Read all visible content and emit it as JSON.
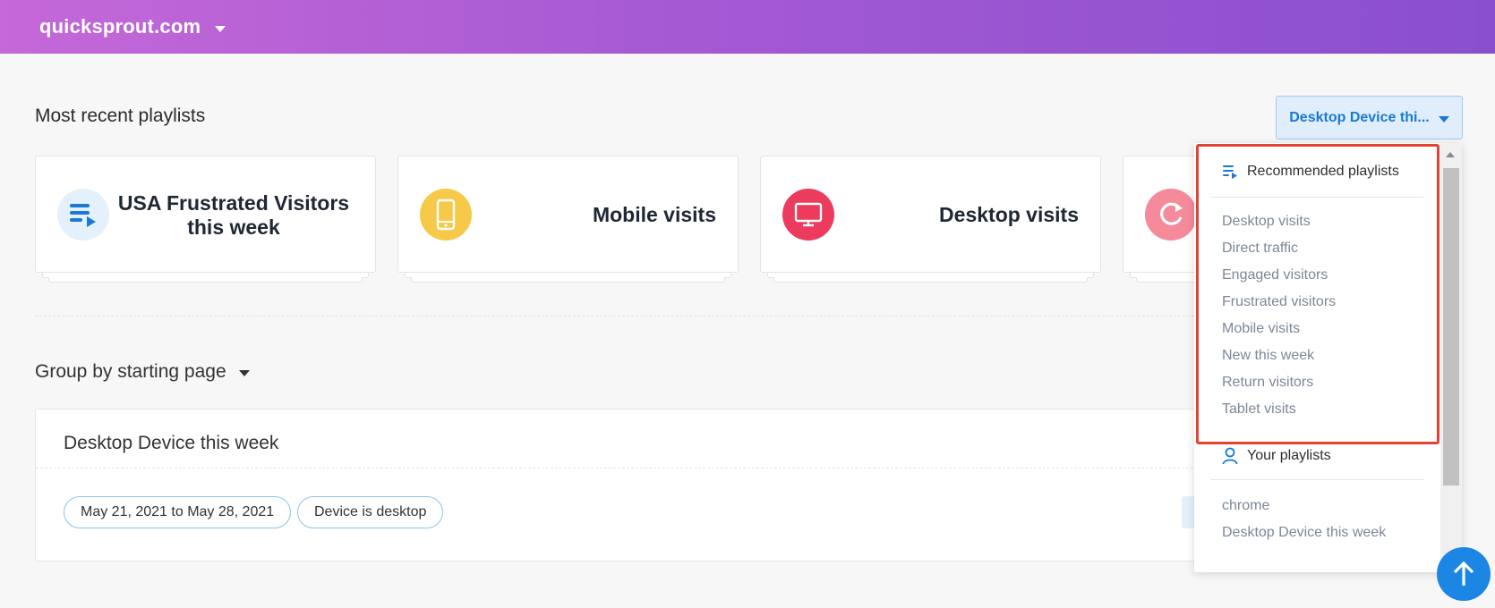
{
  "header": {
    "site_name": "quicksprout.com",
    "gradient_start": "#c568d8",
    "gradient_end": "#8a4fcf"
  },
  "playlists_section": {
    "title": "Most recent playlists",
    "selector_label": "Desktop Device thi...",
    "cards": [
      {
        "title": "USA Frustrated Visitors this week",
        "icon": "playlist-icon",
        "icon_color": "#e4f0fb"
      },
      {
        "title": "Mobile visits",
        "icon": "mobile-icon",
        "icon_color": "#f7c948"
      },
      {
        "title": "Desktop visits",
        "icon": "desktop-icon",
        "icon_color": "#ec3b5c"
      },
      {
        "title": "",
        "icon": "refresh-icon",
        "icon_color": "#f58a9b"
      }
    ]
  },
  "group_by": {
    "label": "Group by starting page"
  },
  "segment": {
    "title": "Desktop Device this week",
    "filters": [
      "May 21, 2021 to May 28, 2021",
      "Device is desktop"
    ]
  },
  "dropdown": {
    "recommended": {
      "heading": "Recommended playlists",
      "items": [
        "Desktop visits",
        "Direct traffic",
        "Engaged visitors",
        "Frustrated visitors",
        "Mobile visits",
        "New this week",
        "Return visitors",
        "Tablet visits"
      ]
    },
    "yours": {
      "heading": "Your playlists",
      "items": [
        "chrome",
        "Desktop Device this week"
      ]
    },
    "highlight_color": "#e34234"
  },
  "colors": {
    "accent": "#1979d6",
    "fab": "#1b86e3"
  }
}
